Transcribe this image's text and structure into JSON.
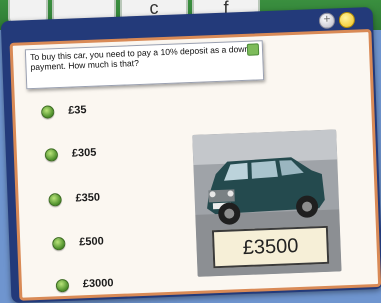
{
  "keyboard_keys": [
    "",
    "",
    "c",
    "f"
  ],
  "question": "To buy this car, you need to pay a 10% deposit as a down payment. How much is that?",
  "options": [
    {
      "label": "£35"
    },
    {
      "label": "£305"
    },
    {
      "label": "£350"
    },
    {
      "label": "£500"
    },
    {
      "label": "£3000"
    }
  ],
  "car_price": "£3500",
  "colors": {
    "background": "#6f95cf",
    "frame": "#233a7a",
    "panel": "#fbf7f1",
    "panel_border": "#d98a56",
    "radio": "#4c8e2a"
  }
}
